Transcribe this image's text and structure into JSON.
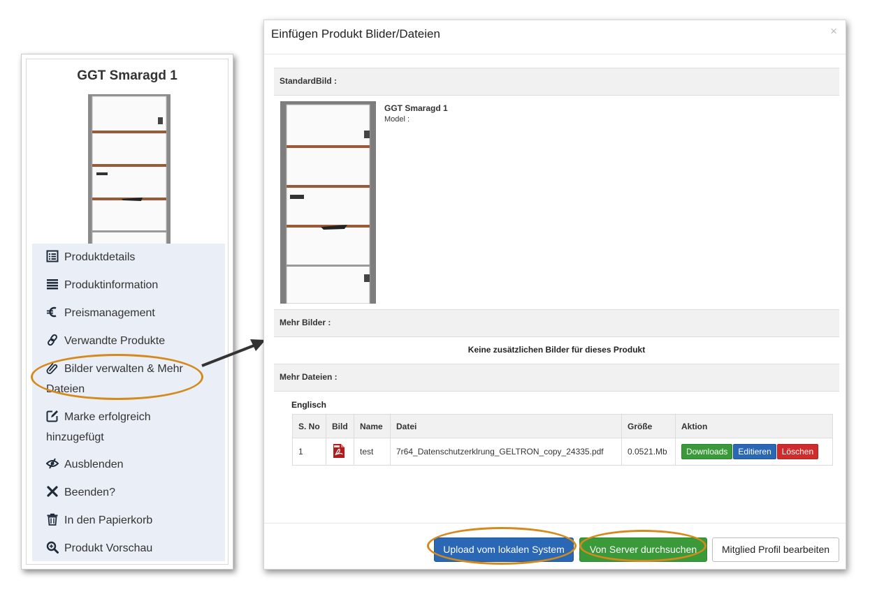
{
  "left_panel": {
    "title": "GGT Smaragd 1",
    "menu": [
      {
        "label": "Produktdetails",
        "icon": "list-alt-icon"
      },
      {
        "label": "Produktinformation",
        "icon": "list-icon"
      },
      {
        "label": "Preismanagement",
        "icon": "euro-icon"
      },
      {
        "label": "Verwandte Produkte",
        "icon": "link-icon"
      },
      {
        "label": "Bilder verwalten & Mehr Dateien",
        "icon": "paperclip-icon"
      },
      {
        "label": "Marke erfolgreich hinzugefügt",
        "icon": "edit-icon"
      },
      {
        "label": "Ausblenden",
        "icon": "eye-slash-icon"
      },
      {
        "label": "Beenden?",
        "icon": "close-icon"
      },
      {
        "label": "In den Papierkorb",
        "icon": "trash-icon"
      },
      {
        "label": "Produkt Vorschau",
        "icon": "zoom-icon"
      }
    ]
  },
  "modal": {
    "title": "Einfügen Produkt Blider/Dateien",
    "close": "×",
    "standard_label": "StandardBild :",
    "product_name": "GGT Smaragd 1",
    "model_label": "Model :",
    "more_images_label": "Mehr Bilder :",
    "no_images_text": "Keine zusätzlichen Bilder für dieses Produkt",
    "more_files_label": "Mehr Dateien :",
    "language": "Englisch",
    "table": {
      "headers": [
        "S. No",
        "Bild",
        "Name",
        "Datei",
        "Größe",
        "Aktion"
      ],
      "rows": [
        {
          "sno": "1",
          "name": "test",
          "file": "7r64_Datenschutzerklrung_GELTRON_copy_24335.pdf",
          "size": "0.0521.Mb"
        }
      ],
      "actions": {
        "download": "Downloads",
        "edit": "Editieren",
        "delete": "Löschen"
      }
    },
    "footer": {
      "upload": "Upload vom lokalen System",
      "server": "Von Server durchsuchen",
      "profile": "Mitglied Profil bearbeiten"
    }
  },
  "colors": {
    "highlight_ring": "#d48a1c",
    "primary": "#2a67b4",
    "success": "#3a9a3a",
    "danger": "#cf2d2d",
    "menu_bg": "#e9eef7"
  }
}
